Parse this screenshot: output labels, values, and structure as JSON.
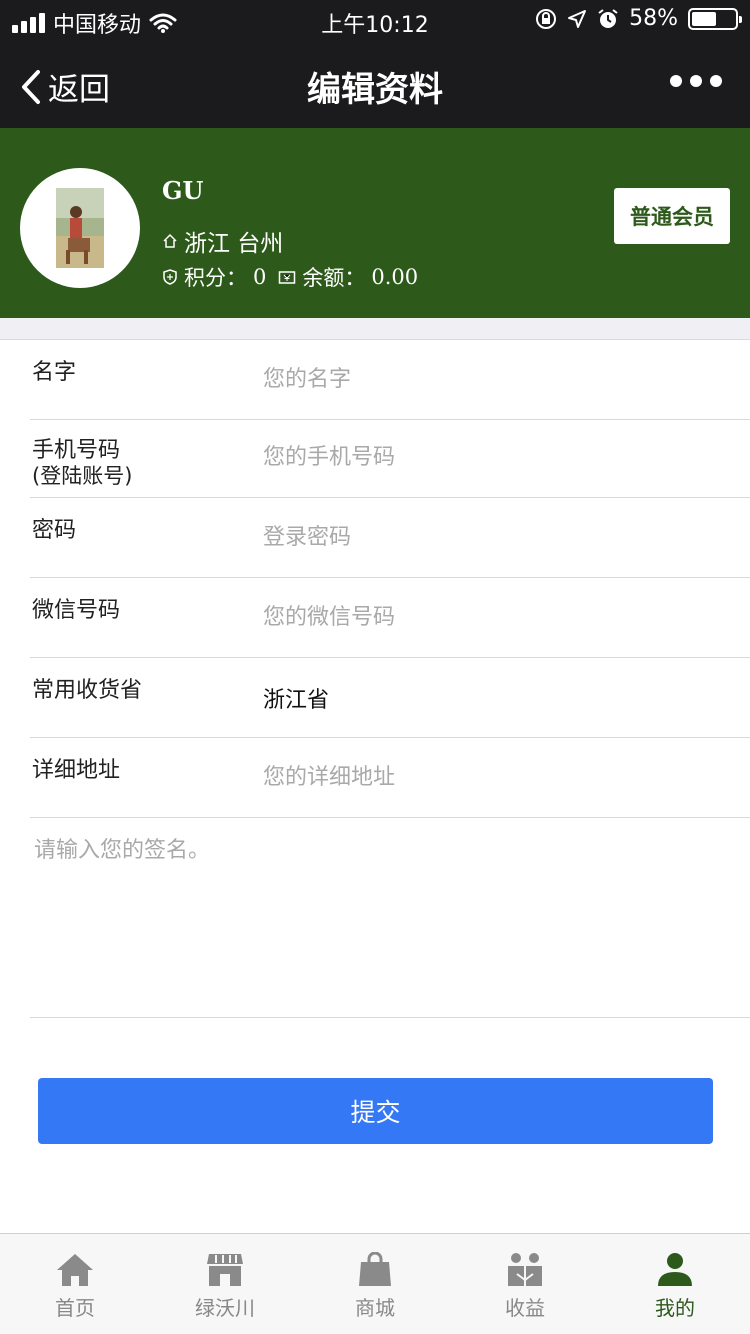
{
  "status_bar": {
    "carrier": "中国移动",
    "time": "上午10:12",
    "battery": "58%",
    "battery_level": 0.58
  },
  "nav": {
    "back_label": "返回",
    "title": "编辑资料"
  },
  "profile": {
    "name": "GU",
    "location": "浙江 台州",
    "points_label": "积分：",
    "points_value": "0",
    "balance_label": "余额：",
    "balance_value": "0.00",
    "member_badge": "普通会员"
  },
  "form": {
    "name_label": "名字",
    "name_placeholder": "您的名字",
    "phone_label": "手机号码",
    "phone_sublabel": "(登陆账号)",
    "phone_placeholder": "您的手机号码",
    "password_label": "密码",
    "password_placeholder": "登录密码",
    "wechat_label": "微信号码",
    "wechat_placeholder": "您的微信号码",
    "province_label": "常用收货省",
    "province_value": "浙江省",
    "address_label": "详细地址",
    "address_placeholder": "您的详细地址",
    "signature_placeholder": "请输入您的签名。",
    "submit_label": "提交"
  },
  "tabbar": {
    "items": [
      {
        "label": "首页",
        "icon": "home-icon"
      },
      {
        "label": "绿沃川",
        "icon": "store-icon"
      },
      {
        "label": "商城",
        "icon": "shopping-bag-icon"
      },
      {
        "label": "收益",
        "icon": "people-icon"
      },
      {
        "label": "我的",
        "icon": "user-icon"
      }
    ],
    "active_index": 4
  },
  "colors": {
    "brand_green": "#2d5a1b",
    "submit_blue": "#3478f6",
    "bar_dark": "#1b1b1d"
  }
}
